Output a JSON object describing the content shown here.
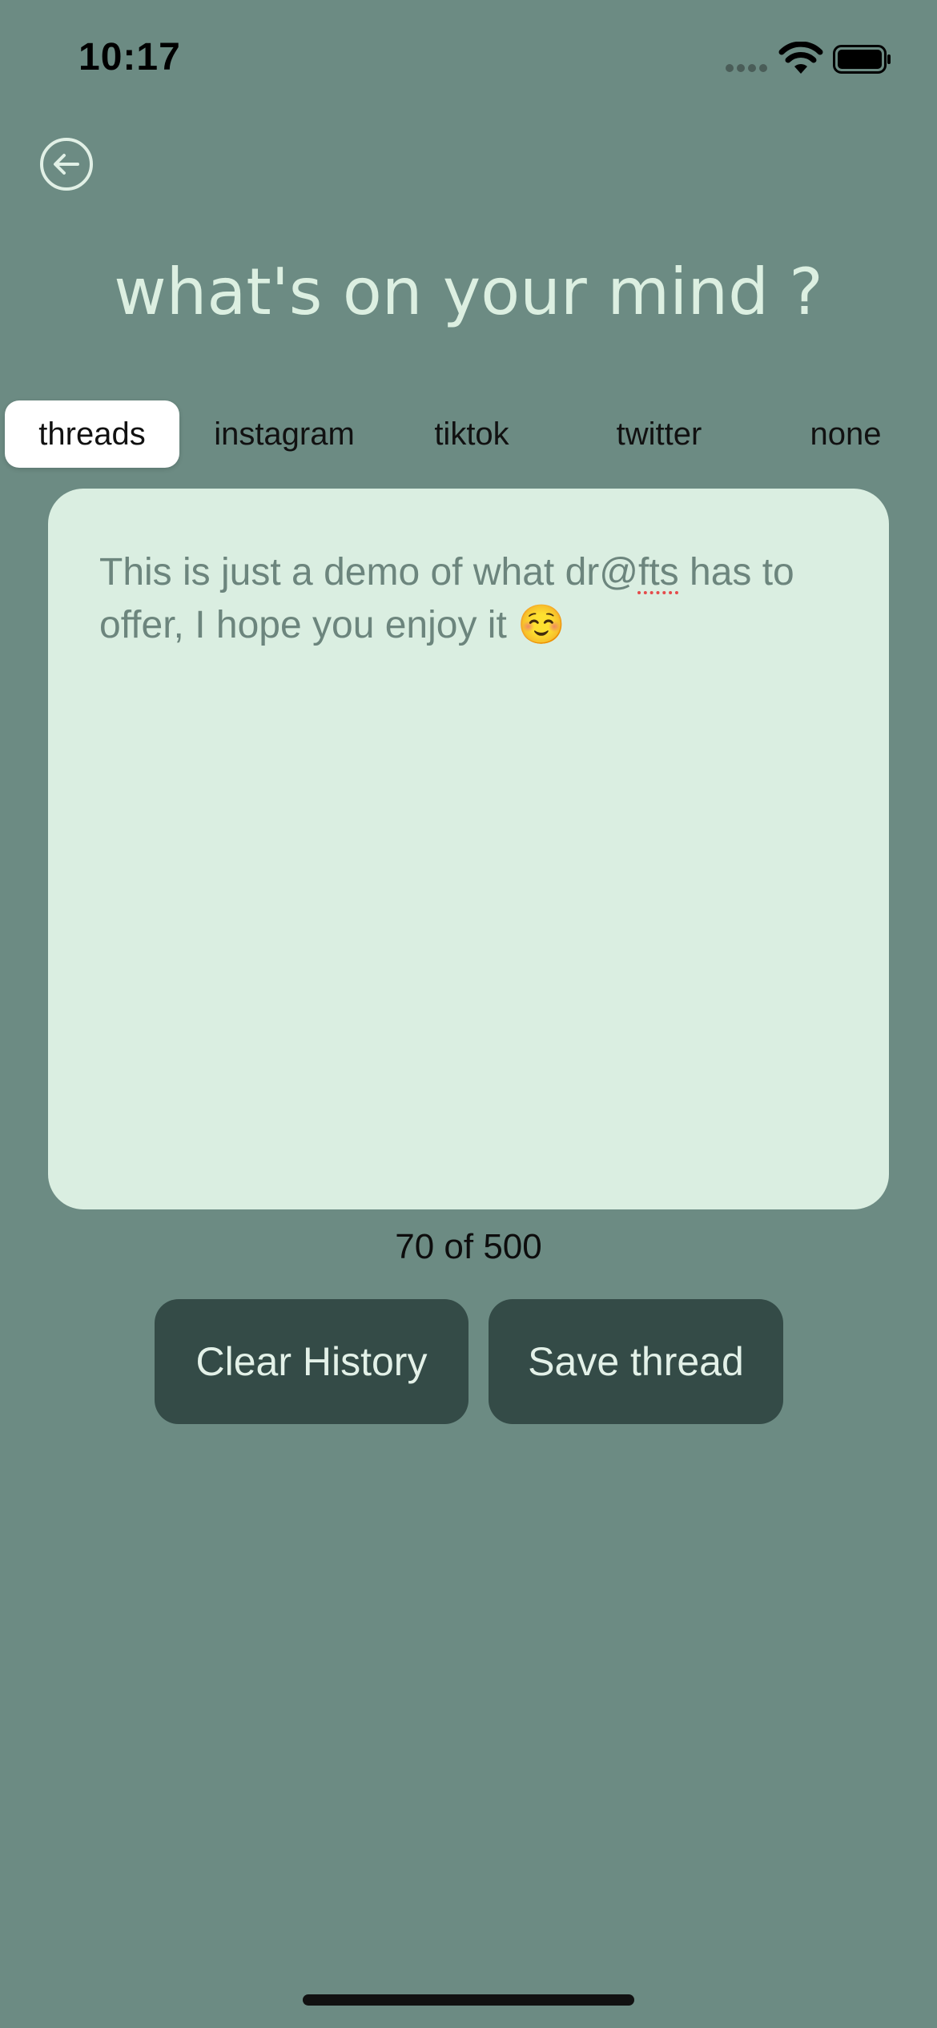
{
  "status_bar": {
    "time": "10:17",
    "icons": [
      "cellular-signal-icon",
      "wifi-icon",
      "battery-icon"
    ]
  },
  "header": {
    "back_icon": "arrow-left-circle-icon",
    "title": "what's on your mind ?"
  },
  "tabs": [
    {
      "label": "threads",
      "active": true
    },
    {
      "label": "instagram",
      "active": false
    },
    {
      "label": "tiktok",
      "active": false
    },
    {
      "label": "twitter",
      "active": false
    },
    {
      "label": "none",
      "active": false
    }
  ],
  "editor": {
    "text_before": "This is just a demo of what dr@",
    "misspelled": "fts",
    "text_after": " has to offer, I hope you enjoy it ☺️"
  },
  "counter": {
    "text": "70 of 500"
  },
  "buttons": {
    "clear_history": "Clear History",
    "save_thread": "Save thread"
  },
  "colors": {
    "background": "#6c8b83",
    "editor_bg": "#daeee1",
    "button_bg": "#344b47",
    "title": "#dcefe1"
  }
}
